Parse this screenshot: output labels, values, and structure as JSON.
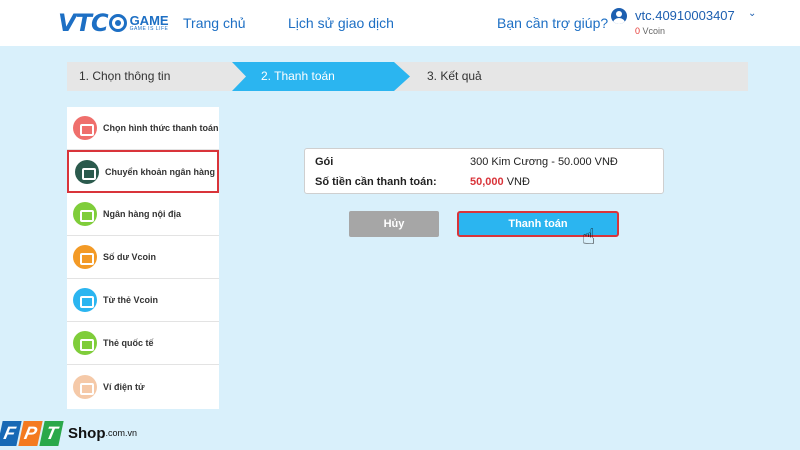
{
  "header": {
    "logo_main": "VTC",
    "logo_game": "GAME",
    "logo_tagline": "GAME IS LIFE",
    "nav_home": "Trang chủ",
    "nav_history": "Lịch sử giao dịch",
    "nav_help": "Bạn cần trợ giúp?",
    "username": "vtc.40910003407",
    "vcoin_amount": "0",
    "vcoin_unit": "Vcoin",
    "chevron": "⌄"
  },
  "steps": [
    {
      "label": "1. Chọn thông tin"
    },
    {
      "label": "2. Thanh toán",
      "active": true
    },
    {
      "label": "3. Kết quả"
    }
  ],
  "sidebar": {
    "items": [
      {
        "label": "Chọn hình thức thanh toán",
        "icon": "wallet-icon",
        "color": "#ef6f6c"
      },
      {
        "label": "Chuyển khoản ngân hàng",
        "icon": "bank-icon",
        "color": "#2b5a4d",
        "selected": true
      },
      {
        "label": "Ngân hàng nội địa",
        "icon": "card-icon",
        "color": "#7fcd3a"
      },
      {
        "label": "Số dư Vcoin",
        "icon": "coin-hand-icon",
        "color": "#f39a26"
      },
      {
        "label": "Từ thẻ Vcoin",
        "icon": "ticket-icon",
        "color": "#2bb5f0"
      },
      {
        "label": "Thẻ quốc tế",
        "icon": "credit-card-icon",
        "color": "#7fcd3a"
      },
      {
        "label": "Ví điện tử",
        "icon": "e-wallet-icon",
        "color": "#f5c9a8"
      }
    ]
  },
  "summary": {
    "package_label": "Gói",
    "package_value": "300 Kim Cương - 50.000 VNĐ",
    "amount_label": "Số tiền cần thanh toán:",
    "amount_value": "50,000",
    "amount_unit": "VNĐ"
  },
  "buttons": {
    "cancel": "Hủy",
    "pay": "Thanh toán"
  },
  "watermark": {
    "f": "F",
    "p": "P",
    "t": "T",
    "shop": "Shop",
    "domain": ".com.vn"
  },
  "colors": {
    "accent": "#2bb5f0",
    "brand": "#1d6fc4",
    "danger": "#d9343a",
    "background": "#d9f0fb"
  }
}
